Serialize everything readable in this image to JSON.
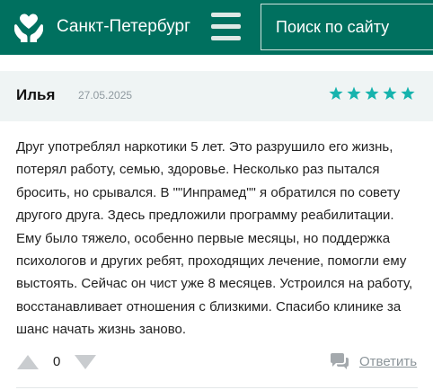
{
  "header": {
    "logo_icon": "heart-in-hands-icon",
    "city": "Санкт-Петербург",
    "menu_icon": "hamburger-menu-icon",
    "search_placeholder": "Поиск по сайту",
    "background_color": "#00705f"
  },
  "review": {
    "author": "Илья",
    "date": "27.05.2025",
    "rating": 5,
    "rating_max": 5,
    "star_color": "#16b3ad",
    "text": "Друг употреблял наркотики 5 лет. Это разрушило его жизнь, потерял работу, семью, здоровье. Несколько раз пытался бросить, но срывался. В \"\"Инпрамед\"\" я обратился по совету другого друга. Здесь предложили программу реабилитации. Ему было тяжело, особенно первые месяцы, но поддержка психологов и других ребят, проходящих лечение, помогли ему выстоять. Сейчас он чист уже 8 месяцев. Устроился на работу, восстанавливает отношения с близкими. Спасибо клинике за шанс начать жизнь заново.",
    "votes": "0",
    "vote_up_icon": "triangle-up-icon",
    "vote_down_icon": "triangle-down-icon",
    "reply_icon": "speech-bubbles-icon",
    "reply_label": "Ответить"
  }
}
